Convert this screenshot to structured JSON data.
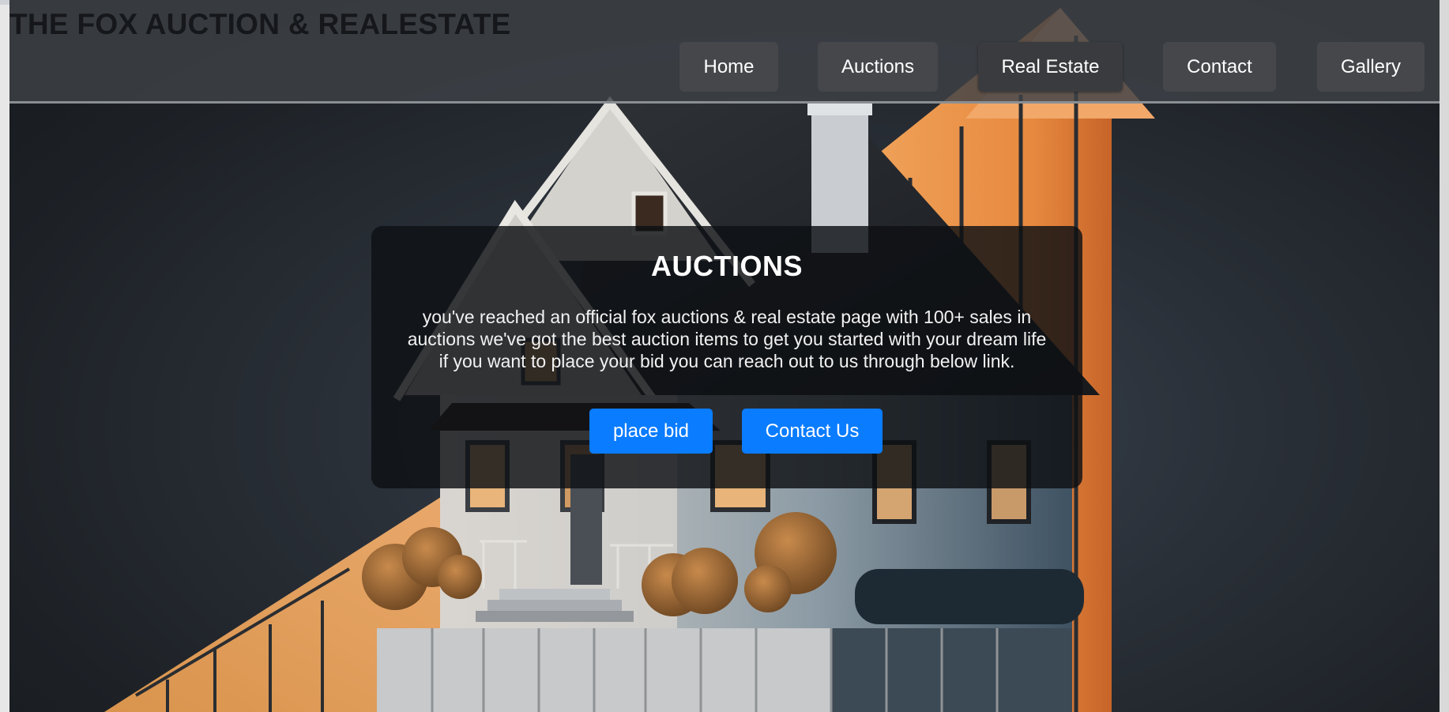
{
  "header": {
    "site_title": "THE FOX AUCTION & REALESTATE",
    "nav": [
      {
        "label": "Home"
      },
      {
        "label": "Auctions"
      },
      {
        "label": "Real Estate"
      },
      {
        "label": "Contact"
      },
      {
        "label": "Gallery"
      }
    ]
  },
  "hero": {
    "title": "AUCTIONS",
    "text": "you've reached an official fox auctions & real estate page with 100+ sales in auctions we've got the best auction items to get you started with your dream life if you want to place your bid you can reach out to us through below link.",
    "buttons": {
      "place_bid": "place bid",
      "contact_us": "Contact Us"
    }
  },
  "colors": {
    "accent": "#0a7cff",
    "nav_button": "#45474b",
    "card_bg": "#0e1013"
  }
}
